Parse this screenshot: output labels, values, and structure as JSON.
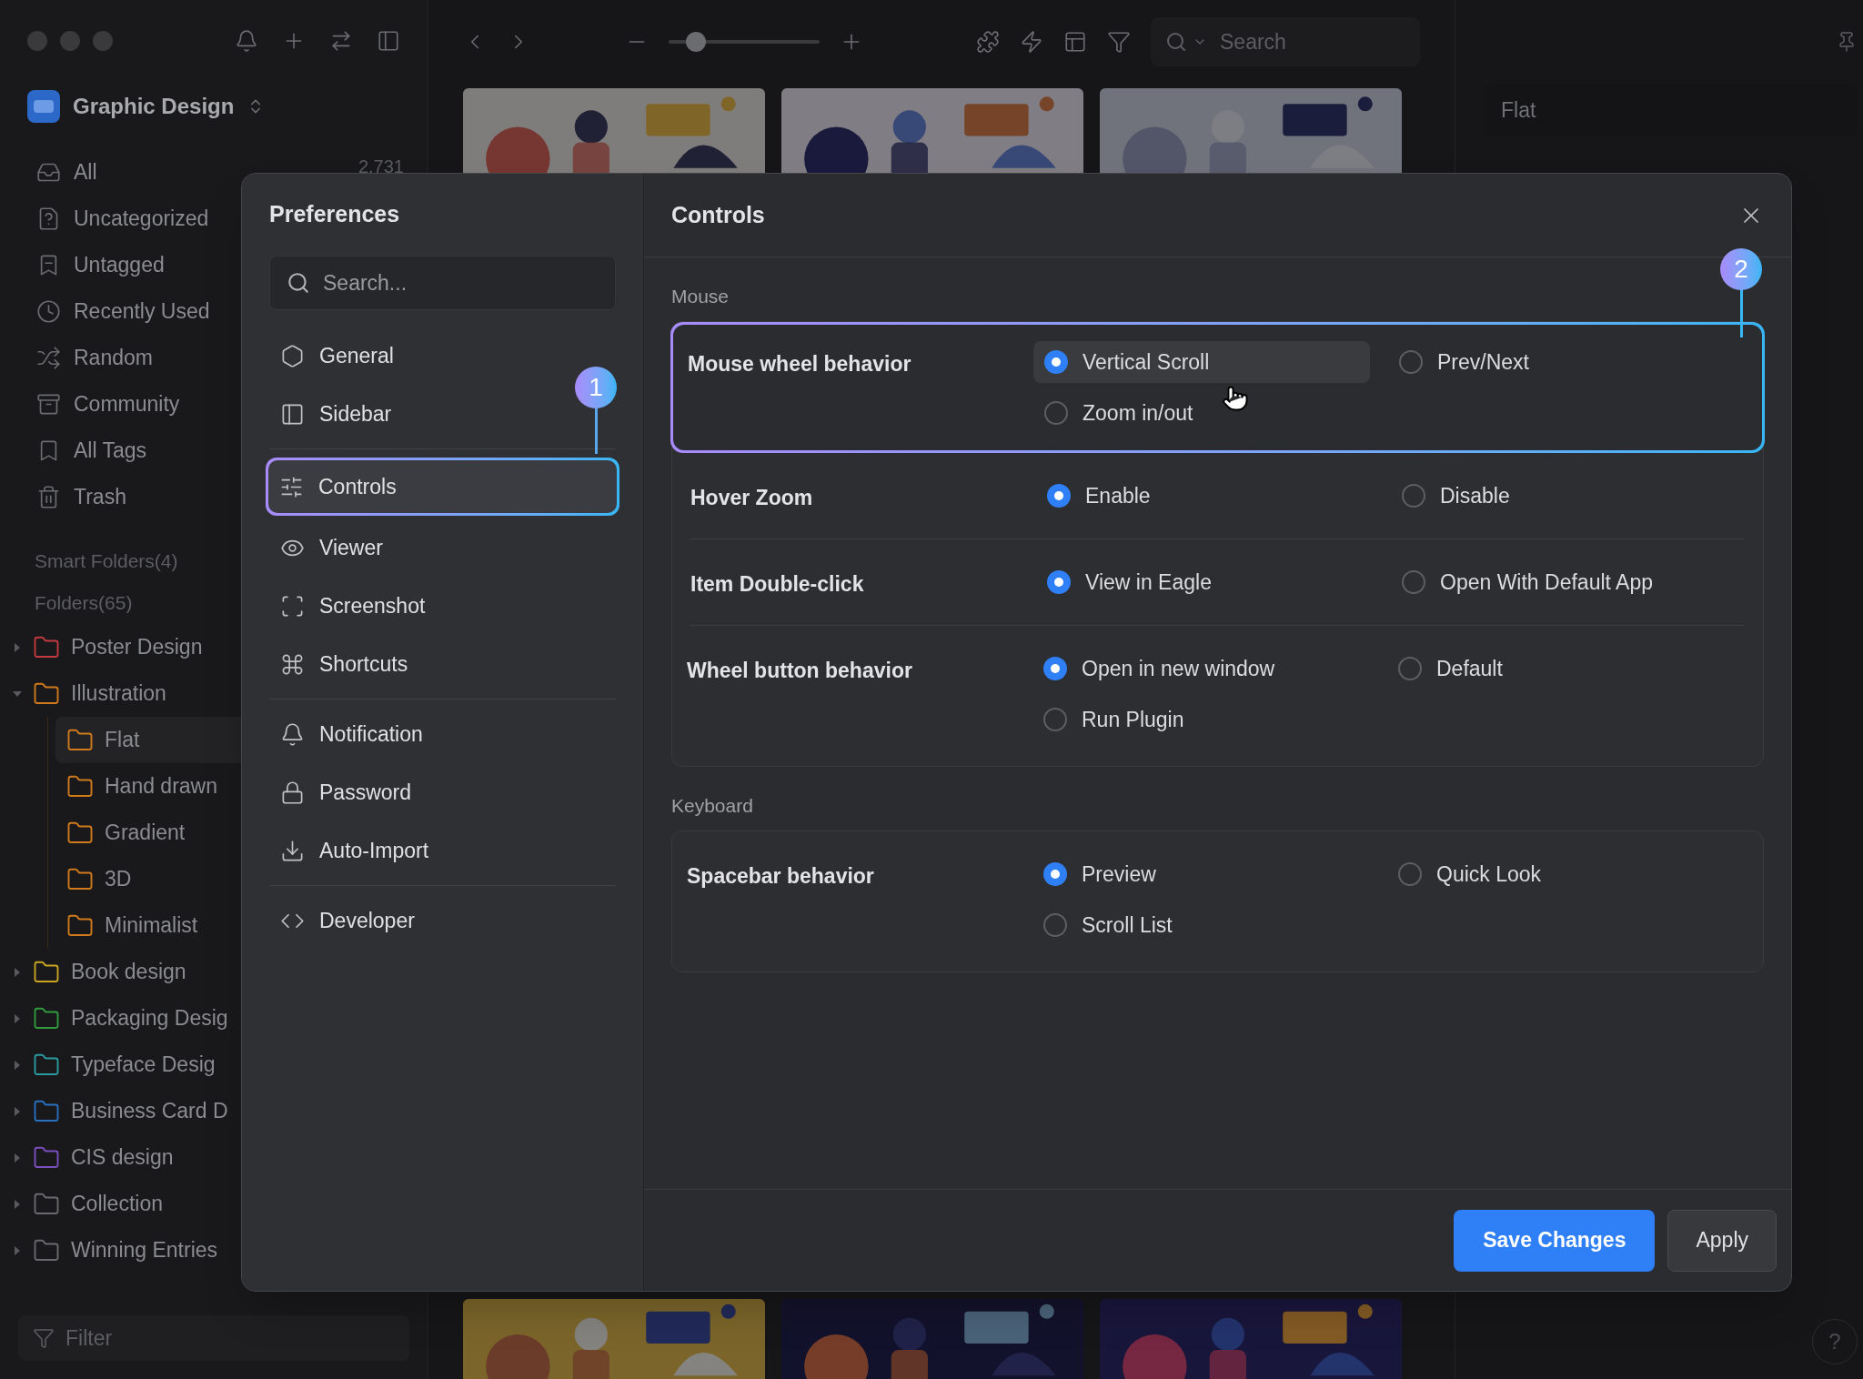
{
  "sidebar": {
    "library": "Graphic Design",
    "items": [
      {
        "label": "All",
        "count": "2,731"
      },
      {
        "label": "Uncategorized"
      },
      {
        "label": "Untagged"
      },
      {
        "label": "Recently Used"
      },
      {
        "label": "Random"
      },
      {
        "label": "Community"
      },
      {
        "label": "All Tags"
      },
      {
        "label": "Trash"
      }
    ],
    "smart_folders": "Smart Folders(4)",
    "folders_heading": "Folders(65)",
    "folders": [
      {
        "label": "Poster Design",
        "color": "#c23a3f",
        "expanded": false,
        "selected": false
      },
      {
        "label": "Illustration",
        "color": "#d07a1c",
        "expanded": true,
        "selected": false,
        "children": [
          {
            "label": "Flat",
            "color": "#d07a1c",
            "selected": true
          },
          {
            "label": "Hand drawn",
            "color": "#d07a1c",
            "selected": false
          },
          {
            "label": "Gradient",
            "color": "#d07a1c",
            "selected": false
          },
          {
            "label": "3D",
            "color": "#d07a1c",
            "selected": false
          },
          {
            "label": "Minimalist",
            "color": "#d07a1c",
            "selected": false
          }
        ]
      },
      {
        "label": "Book design",
        "color": "#c9a520",
        "expanded": false,
        "selected": false
      },
      {
        "label": "Packaging Desig",
        "color": "#2f9a3e",
        "expanded": false,
        "selected": false
      },
      {
        "label": "Typeface Desig",
        "color": "#2a9aa0",
        "expanded": false,
        "selected": false
      },
      {
        "label": "Business Card D",
        "color": "#2a6fc0",
        "expanded": false,
        "selected": false
      },
      {
        "label": "CIS design",
        "color": "#7b4fc0",
        "expanded": false,
        "selected": false
      },
      {
        "label": "Collection",
        "color": "#6a6a6e",
        "expanded": false,
        "selected": false
      },
      {
        "label": "Winning Entries",
        "color": "#6a6a6e",
        "expanded": false,
        "selected": false
      }
    ],
    "filter": {
      "placeholder": "Filter"
    }
  },
  "toolbar": {
    "zoom": {
      "level": 0.13
    },
    "search": {
      "placeholder": "Search"
    }
  },
  "inspector": {
    "name_field": {
      "value": "Flat"
    },
    "help": "?"
  },
  "preferences": {
    "title": "Preferences",
    "search": {
      "placeholder": "Search..."
    },
    "nav_groups": [
      [
        {
          "label": "General",
          "selected": false
        },
        {
          "label": "Sidebar",
          "selected": false
        }
      ],
      [
        {
          "label": "Controls",
          "selected": true
        },
        {
          "label": "Viewer",
          "selected": false
        },
        {
          "label": "Screenshot",
          "selected": false
        },
        {
          "label": "Shortcuts",
          "selected": false
        }
      ],
      [
        {
          "label": "Notification",
          "selected": false
        },
        {
          "label": "Password",
          "selected": false
        },
        {
          "label": "Auto-Import",
          "selected": false
        }
      ],
      [
        {
          "label": "Developer",
          "selected": false
        }
      ]
    ],
    "callouts": [
      "1",
      "2"
    ],
    "page_title": "Controls",
    "sections": [
      {
        "title": "Mouse",
        "rows": [
          {
            "label": "Mouse wheel behavior",
            "highlighted": true,
            "options": [
              {
                "label": "Vertical Scroll",
                "selected": true,
                "hovered": true
              },
              {
                "label": "Prev/Next",
                "selected": false,
                "hovered": false
              },
              {
                "label": "Zoom in/out",
                "selected": false,
                "hovered": false
              }
            ]
          },
          {
            "label": "Hover Zoom",
            "highlighted": false,
            "options": [
              {
                "label": "Enable",
                "selected": true,
                "hovered": false
              },
              {
                "label": "Disable",
                "selected": false,
                "hovered": false
              }
            ]
          },
          {
            "label": "Item Double-click",
            "highlighted": false,
            "options": [
              {
                "label": "View in Eagle",
                "selected": true,
                "hovered": false
              },
              {
                "label": "Open With Default App",
                "selected": false,
                "hovered": false
              }
            ]
          },
          {
            "label": "Wheel button behavior",
            "highlighted": false,
            "options": [
              {
                "label": "Open in new window",
                "selected": true,
                "hovered": false
              },
              {
                "label": "Default",
                "selected": false,
                "hovered": false
              },
              {
                "label": "Run Plugin",
                "selected": false,
                "hovered": false
              }
            ]
          }
        ]
      },
      {
        "title": "Keyboard",
        "rows": [
          {
            "label": "Spacebar behavior",
            "highlighted": false,
            "options": [
              {
                "label": "Preview",
                "selected": true,
                "hovered": false
              },
              {
                "label": "Quick Look",
                "selected": false,
                "hovered": false
              },
              {
                "label": "Scroll List",
                "selected": false,
                "hovered": false
              }
            ]
          }
        ]
      }
    ],
    "buttons": [
      {
        "label": "Save Changes",
        "kind": "primary"
      },
      {
        "label": "Apply",
        "kind": "secondary"
      }
    ]
  }
}
